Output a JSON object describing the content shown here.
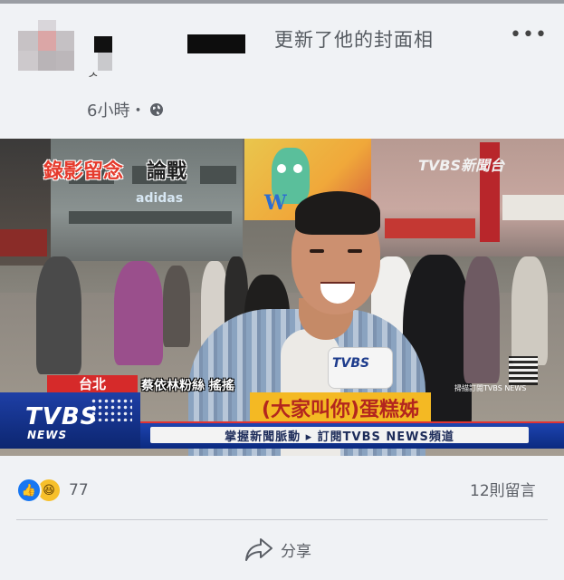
{
  "post": {
    "author_stub": "ᄼ",
    "action_text": "更新了他的封面相",
    "time": "6小時・",
    "more_label": "•••"
  },
  "photo": {
    "overlay_title_red": "錄影留念",
    "overlay_title_dark": "論戰",
    "storefront_sign": "adidas",
    "watermark": "TVBS新聞台",
    "location_tag": "台北",
    "source_text": "蔡依林粉絲  搖搖",
    "caption": "(大家叫你)蛋糕姊",
    "mic_logo": "TVBS",
    "logo_main": "TVBS",
    "logo_sub": "NEWS",
    "ticker": "掌握新聞脈動 ▸ 訂閱TVBS NEWS頻道",
    "qr_label": "掃描訂閱TVBS NEWS"
  },
  "footer": {
    "reaction_count": "77",
    "comment_count": "12則留言",
    "share_label": "分享",
    "like_glyph": "👍",
    "haha_glyph": "😆"
  },
  "colors": {
    "accent": "#1877f2",
    "tvbs_blue": "#1e3fa6",
    "caption_bg": "#f4b923",
    "caption_text": "#b3261e",
    "location_red": "#d62a2a"
  }
}
